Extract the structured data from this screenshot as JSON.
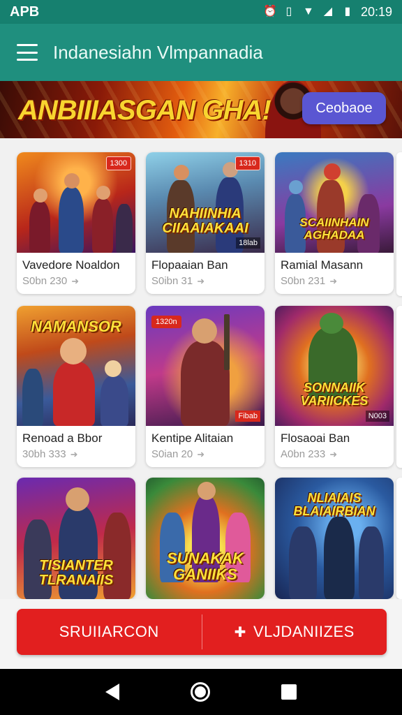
{
  "status_bar": {
    "carrier": "APB",
    "time": "20:19"
  },
  "app_bar": {
    "title": "Indanesiahn Vlmpannadia"
  },
  "banner": {
    "title": "ANBIIIASGAN GHA!",
    "button_label": "Ceobaoe"
  },
  "cards": [
    {
      "name": "Vavedore Noaldon",
      "meta": "S0bn 230",
      "thumb_text": "",
      "badge": ""
    },
    {
      "name": "Flopaaian Ban",
      "meta": "S0ibn 31",
      "thumb_text": "NAHIINHIA CIIAAIAKAAI",
      "badge": ""
    },
    {
      "name": "Ramial Masann",
      "meta": "S0bn 231",
      "thumb_text": "SCAIINHAIN AGHADAA",
      "badge": ""
    },
    {
      "name": "Renoad a Bbor",
      "meta": "30bh 333",
      "thumb_text": "NAMANSOR",
      "badge": ""
    },
    {
      "name": "Kentipe Alitaian",
      "meta": "S0ian 20",
      "thumb_text": "",
      "badge": ""
    },
    {
      "name": "Flosaoai Ban",
      "meta": "A0bn 233",
      "thumb_text": "SONNAIIK VARIICKES",
      "badge": ""
    },
    {
      "name": "",
      "meta": "",
      "thumb_text": "TISIANTER TLRANAIIS",
      "badge": ""
    },
    {
      "name": "",
      "meta": "",
      "thumb_text": "SUNAKAK GANIIKS",
      "badge": ""
    },
    {
      "name": "",
      "meta": "",
      "thumb_text": "NLIAIAIS BLAIAIRBIAN",
      "badge": ""
    }
  ],
  "thumb_labels": {
    "c0_badge": "1300",
    "c1_badge": "1310",
    "c1_corner": "18lab",
    "c4_badge_left": "1320n",
    "c4_corner": "Fibab",
    "c5_corner": "N003"
  },
  "actions": {
    "left_label": "SRUIIARCON",
    "right_label": "VLJDANIIZES"
  },
  "colors": {
    "app_bar": "#1f8f7e",
    "status_bar": "#16806f",
    "action_red": "#e21f1f",
    "banner_button": "#5a56d2"
  }
}
